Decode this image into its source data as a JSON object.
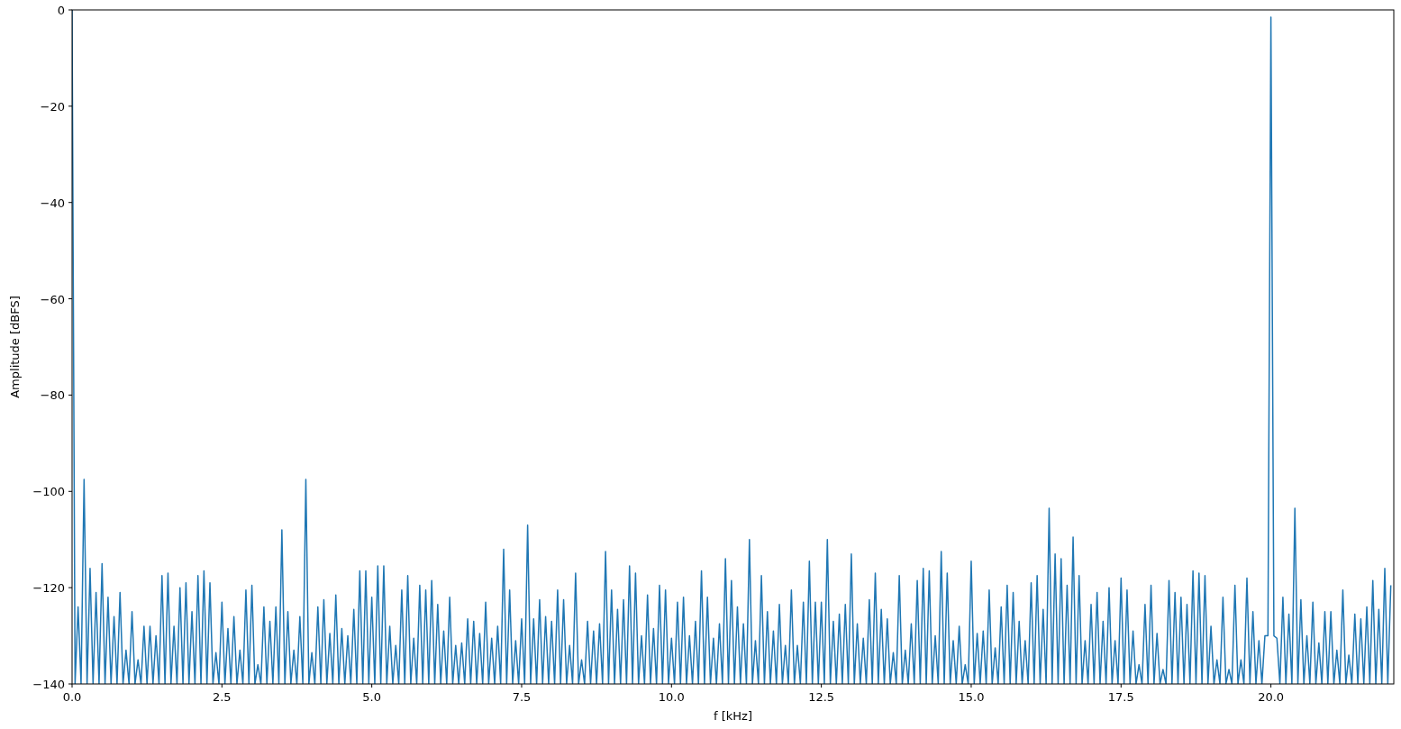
{
  "chart_data": {
    "type": "line",
    "xlabel": "f [kHz]",
    "ylabel": "Amplitude [dBFS]",
    "xlim": [
      0,
      22.05
    ],
    "ylim": [
      -140,
      0
    ],
    "xticks": [
      {
        "value": 0,
        "label": "0.0"
      },
      {
        "value": 2.5,
        "label": "2.5"
      },
      {
        "value": 5,
        "label": "5.0"
      },
      {
        "value": 7.5,
        "label": "7.5"
      },
      {
        "value": 10,
        "label": "10.0"
      },
      {
        "value": 12.5,
        "label": "12.5"
      },
      {
        "value": 15,
        "label": "15.0"
      },
      {
        "value": 17.5,
        "label": "17.5"
      },
      {
        "value": 20,
        "label": "20.0"
      }
    ],
    "yticks": [
      {
        "value": 0,
        "label": "0"
      },
      {
        "value": -20,
        "label": "−20"
      },
      {
        "value": -40,
        "label": "−40"
      },
      {
        "value": -60,
        "label": "−60"
      },
      {
        "value": -80,
        "label": "−80"
      },
      {
        "value": -100,
        "label": "−100"
      },
      {
        "value": -120,
        "label": "−120"
      },
      {
        "value": -140,
        "label": "−140"
      }
    ],
    "x": [
      0,
      0.05,
      0.1,
      0.15,
      0.2,
      0.25,
      0.3,
      0.35,
      0.4,
      0.45,
      0.5,
      0.55,
      0.6,
      0.65,
      0.7,
      0.75,
      0.8,
      0.85,
      0.9,
      0.95,
      1,
      1.05,
      1.1,
      1.15,
      1.2,
      1.25,
      1.3,
      1.35,
      1.4,
      1.45,
      1.5,
      1.55,
      1.6,
      1.65,
      1.7,
      1.75,
      1.8,
      1.85,
      1.9,
      1.95,
      2,
      2.05,
      2.1,
      2.15,
      2.2,
      2.25,
      2.3,
      2.35,
      2.4,
      2.45,
      2.5,
      2.55,
      2.6,
      2.65,
      2.7,
      2.75,
      2.8,
      2.85,
      2.9,
      2.95,
      3,
      3.05,
      3.1,
      3.15,
      3.2,
      3.25,
      3.3,
      3.35,
      3.4,
      3.45,
      3.5,
      3.55,
      3.6,
      3.65,
      3.7,
      3.75,
      3.8,
      3.85,
      3.9,
      3.95,
      4,
      4.05,
      4.1,
      4.15,
      4.2,
      4.25,
      4.3,
      4.35,
      4.4,
      4.45,
      4.5,
      4.55,
      4.6,
      4.65,
      4.7,
      4.75,
      4.8,
      4.85,
      4.9,
      4.95,
      5,
      5.05,
      5.1,
      5.15,
      5.2,
      5.25,
      5.3,
      5.35,
      5.4,
      5.45,
      5.5,
      5.55,
      5.6,
      5.65,
      5.7,
      5.75,
      5.8,
      5.85,
      5.9,
      5.95,
      6,
      6.05,
      6.1,
      6.15,
      6.2,
      6.25,
      6.3,
      6.35,
      6.4,
      6.45,
      6.5,
      6.55,
      6.6,
      6.65,
      6.7,
      6.75,
      6.8,
      6.85,
      6.9,
      6.95,
      7,
      7.05,
      7.1,
      7.15,
      7.2,
      7.25,
      7.3,
      7.35,
      7.4,
      7.45,
      7.5,
      7.55,
      7.6,
      7.65,
      7.7,
      7.75,
      7.8,
      7.85,
      7.9,
      7.95,
      8,
      8.05,
      8.1,
      8.15,
      8.2,
      8.25,
      8.3,
      8.35,
      8.4,
      8.45,
      8.5,
      8.55,
      8.6,
      8.65,
      8.7,
      8.75,
      8.8,
      8.85,
      8.9,
      8.95,
      9,
      9.05,
      9.1,
      9.15,
      9.2,
      9.25,
      9.3,
      9.35,
      9.4,
      9.45,
      9.5,
      9.55,
      9.6,
      9.65,
      9.7,
      9.75,
      9.8,
      9.85,
      9.9,
      9.95,
      10,
      10.05,
      10.1,
      10.15,
      10.2,
      10.25,
      10.3,
      10.35,
      10.4,
      10.45,
      10.5,
      10.55,
      10.6,
      10.65,
      10.7,
      10.75,
      10.8,
      10.85,
      10.9,
      10.95,
      11,
      11.05,
      11.1,
      11.15,
      11.2,
      11.25,
      11.3,
      11.35,
      11.4,
      11.45,
      11.5,
      11.55,
      11.6,
      11.65,
      11.7,
      11.75,
      11.8,
      11.85,
      11.9,
      11.95,
      12,
      12.05,
      12.1,
      12.15,
      12.2,
      12.25,
      12.3,
      12.35,
      12.4,
      12.45,
      12.5,
      12.55,
      12.6,
      12.65,
      12.7,
      12.75,
      12.8,
      12.85,
      12.9,
      12.95,
      13,
      13.05,
      13.1,
      13.15,
      13.2,
      13.25,
      13.3,
      13.35,
      13.4,
      13.45,
      13.5,
      13.55,
      13.6,
      13.65,
      13.7,
      13.75,
      13.8,
      13.85,
      13.9,
      13.95,
      14,
      14.05,
      14.1,
      14.15,
      14.2,
      14.25,
      14.3,
      14.35,
      14.4,
      14.45,
      14.5,
      14.55,
      14.6,
      14.65,
      14.7,
      14.75,
      14.8,
      14.85,
      14.9,
      14.95,
      15,
      15.05,
      15.1,
      15.15,
      15.2,
      15.25,
      15.3,
      15.35,
      15.4,
      15.45,
      15.5,
      15.55,
      15.6,
      15.65,
      15.7,
      15.75,
      15.8,
      15.85,
      15.9,
      15.95,
      16,
      16.05,
      16.1,
      16.15,
      16.2,
      16.25,
      16.3,
      16.35,
      16.4,
      16.45,
      16.5,
      16.55,
      16.6,
      16.65,
      16.7,
      16.75,
      16.8,
      16.85,
      16.9,
      16.95,
      17,
      17.05,
      17.1,
      17.15,
      17.2,
      17.25,
      17.3,
      17.35,
      17.4,
      17.45,
      17.5,
      17.55,
      17.6,
      17.65,
      17.7,
      17.75,
      17.8,
      17.85,
      17.9,
      17.95,
      18,
      18.05,
      18.1,
      18.15,
      18.2,
      18.25,
      18.3,
      18.35,
      18.4,
      18.45,
      18.5,
      18.55,
      18.6,
      18.65,
      18.7,
      18.75,
      18.8,
      18.85,
      18.9,
      18.95,
      19,
      19.05,
      19.1,
      19.15,
      19.2,
      19.25,
      19.3,
      19.35,
      19.4,
      19.45,
      19.5,
      19.55,
      19.6,
      19.65,
      19.7,
      19.75,
      19.8,
      19.85,
      19.9,
      19.95,
      20,
      20.05,
      20.1,
      20.15,
      20.2,
      20.25,
      20.3,
      20.35,
      20.4,
      20.45,
      20.5,
      20.55,
      20.6,
      20.65,
      20.7,
      20.75,
      20.8,
      20.85,
      20.9,
      20.95,
      21,
      21.05,
      21.1,
      21.15,
      21.2,
      21.25,
      21.3,
      21.35,
      21.4,
      21.45,
      21.5,
      21.55,
      21.6,
      21.65,
      21.7,
      21.75,
      21.8,
      21.85,
      21.9,
      21.95,
      22
    ],
    "series": [
      {
        "color": "#1f77b4",
        "values": [
          0,
          -140,
          -124,
          -140,
          -97.5,
          -140,
          -116,
          -140,
          -121,
          -140,
          -115,
          -140,
          -122,
          -140,
          -126,
          -140,
          -121,
          -140,
          -133,
          -140,
          -125,
          -140,
          -135,
          -140,
          -128,
          -140,
          -128,
          -140,
          -130,
          -140,
          -117.5,
          -140,
          -117,
          -140,
          -128,
          -140,
          -120,
          -140,
          -119,
          -140,
          -125,
          -140,
          -117.5,
          -140,
          -116.5,
          -140,
          -119,
          -140,
          -133.5,
          -140,
          -123,
          -140,
          -128.5,
          -140,
          -126,
          -140,
          -133,
          -140,
          -120.5,
          -140,
          -119.5,
          -140,
          -136,
          -140,
          -124,
          -140,
          -127,
          -140,
          -124,
          -140,
          -108,
          -140,
          -125,
          -140,
          -133,
          -140,
          -126,
          -140,
          -97.5,
          -140,
          -133.5,
          -140,
          -124,
          -140,
          -122.5,
          -140,
          -129.5,
          -140,
          -121.5,
          -140,
          -128.5,
          -140,
          -130,
          -140,
          -124.5,
          -140,
          -116.5,
          -140,
          -116.5,
          -140,
          -122,
          -140,
          -115.5,
          -140,
          -115.5,
          -140,
          -128,
          -140,
          -132,
          -140,
          -120.5,
          -140,
          -117.5,
          -140,
          -130.5,
          -140,
          -119.5,
          -140,
          -120.5,
          -140,
          -118.5,
          -140,
          -123.5,
          -140,
          -129,
          -140,
          -122,
          -140,
          -132,
          -140,
          -131.5,
          -140,
          -126.5,
          -140,
          -127,
          -140,
          -129.5,
          -140,
          -123,
          -140,
          -130.5,
          -140,
          -128,
          -140,
          -112,
          -140,
          -120.5,
          -140,
          -131,
          -140,
          -126.5,
          -140,
          -107,
          -140,
          -126.5,
          -140,
          -122.5,
          -140,
          -126,
          -140,
          -127,
          -140,
          -120.5,
          -140,
          -122.5,
          -140,
          -132,
          -140,
          -117,
          -140,
          -135,
          -140,
          -127,
          -140,
          -129,
          -140,
          -127.5,
          -140,
          -112.5,
          -140,
          -120.5,
          -140,
          -124.5,
          -140,
          -122.5,
          -140,
          -115.5,
          -140,
          -117,
          -140,
          -130,
          -140,
          -121.5,
          -140,
          -128.5,
          -140,
          -119.5,
          -140,
          -120.5,
          -140,
          -130.5,
          -140,
          -123,
          -140,
          -122,
          -140,
          -130,
          -140,
          -127,
          -140,
          -116.5,
          -140,
          -122,
          -140,
          -130.5,
          -140,
          -127.5,
          -140,
          -114,
          -140,
          -118.5,
          -140,
          -124,
          -140,
          -127.5,
          -140,
          -110,
          -140,
          -131,
          -140,
          -117.5,
          -140,
          -125,
          -140,
          -129,
          -140,
          -123.5,
          -140,
          -132,
          -140,
          -120.5,
          -140,
          -132,
          -140,
          -123,
          -140,
          -114.5,
          -140,
          -123,
          -140,
          -123,
          -140,
          -110,
          -140,
          -127,
          -140,
          -125.5,
          -140,
          -123.5,
          -140,
          -113,
          -140,
          -127.5,
          -140,
          -130.5,
          -140,
          -122.5,
          -140,
          -117,
          -140,
          -124.5,
          -140,
          -126.5,
          -140,
          -133.5,
          -140,
          -117.5,
          -140,
          -133,
          -140,
          -127.5,
          -140,
          -118.5,
          -140,
          -116,
          -140,
          -116.5,
          -140,
          -130,
          -140,
          -112.5,
          -140,
          -117,
          -140,
          -131,
          -140,
          -128,
          -140,
          -136,
          -140,
          -114.5,
          -140,
          -129.5,
          -140,
          -129,
          -140,
          -120.5,
          -140,
          -132.5,
          -140,
          -124,
          -140,
          -119.5,
          -140,
          -121,
          -140,
          -127,
          -140,
          -131,
          -140,
          -119,
          -140,
          -117.5,
          -140,
          -124.5,
          -140,
          -103.5,
          -140,
          -113,
          -140,
          -114,
          -140,
          -119.5,
          -140,
          -109.5,
          -140,
          -117.5,
          -140,
          -131,
          -140,
          -123.5,
          -140,
          -121,
          -140,
          -127,
          -140,
          -120,
          -140,
          -131,
          -140,
          -118,
          -140,
          -120.5,
          -140,
          -129,
          -140,
          -136,
          -140,
          -123.5,
          -140,
          -119.5,
          -140,
          -129.5,
          -140,
          -137,
          -140,
          -118.5,
          -140,
          -121,
          -140,
          -122,
          -140,
          -123.5,
          -140,
          -116.5,
          -140,
          -117,
          -140,
          -117.5,
          -140,
          -128,
          -140,
          -135,
          -140,
          -122,
          -140,
          -137,
          -140,
          -119.5,
          -140,
          -135,
          -140,
          -118,
          -140,
          -125,
          -140,
          -131,
          -140,
          -130,
          -130,
          -1.5,
          -130,
          -130.5,
          -140,
          -122,
          -140,
          -125.5,
          -140,
          -103.5,
          -140,
          -122.5,
          -140,
          -130,
          -140,
          -123,
          -140,
          -131.5,
          -140,
          -125,
          -140,
          -125,
          -140,
          -133,
          -140,
          -120.5,
          -140,
          -134,
          -140,
          -125.5,
          -140,
          -126.5,
          -140,
          -124,
          -140,
          -118.5,
          -140,
          -124.5,
          -140,
          -116,
          -140,
          -119.5
        ]
      }
    ]
  }
}
